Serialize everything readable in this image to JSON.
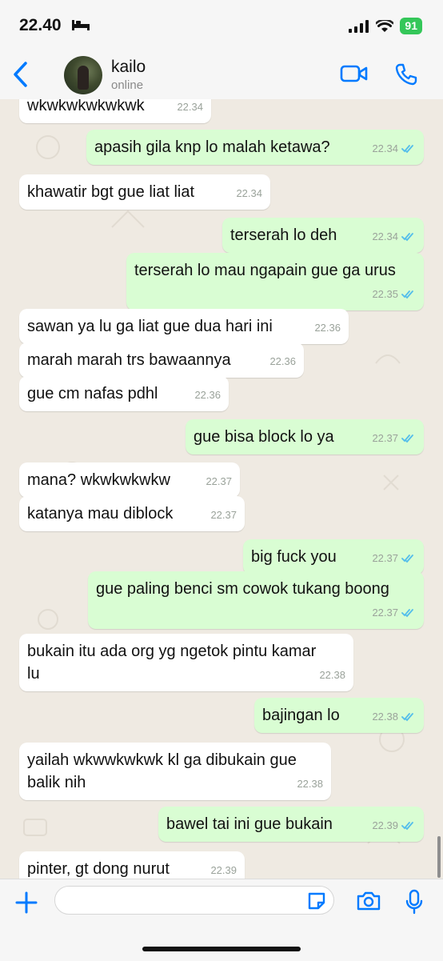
{
  "status_bar": {
    "time": "22.40",
    "battery": "91"
  },
  "header": {
    "contact_name": "kailo",
    "contact_status": "online"
  },
  "messages": [
    {
      "dir": "in",
      "text": "wkwkwkwkwkwk",
      "time": "22.34",
      "read": false
    },
    {
      "dir": "out",
      "text": "apasih gila knp lo malah ketawa?",
      "time": "22.34",
      "read": true
    },
    {
      "dir": "in",
      "text": "khawatir bgt gue liat liat",
      "time": "22.34",
      "read": false
    },
    {
      "dir": "out",
      "text": "terserah lo deh",
      "time": "22.34",
      "read": true
    },
    {
      "dir": "out",
      "text": "terserah lo mau ngapain gue ga urus",
      "time": "22.35",
      "read": true
    },
    {
      "dir": "in",
      "text": "sawan ya lu ga liat gue dua hari ini",
      "time": "22.36",
      "read": false
    },
    {
      "dir": "in",
      "text": "marah marah trs bawaannya",
      "time": "22.36",
      "read": false
    },
    {
      "dir": "in",
      "text": "gue cm nafas pdhl",
      "time": "22.36",
      "read": false
    },
    {
      "dir": "out",
      "text": "gue bisa block lo ya",
      "time": "22.37",
      "read": true
    },
    {
      "dir": "in",
      "text": "mana? wkwkwkwkw",
      "time": "22.37",
      "read": false
    },
    {
      "dir": "in",
      "text": "katanya mau diblock",
      "time": "22.37",
      "read": false
    },
    {
      "dir": "out",
      "text": "big fuck you",
      "time": "22.37",
      "read": true
    },
    {
      "dir": "out",
      "text": "gue paling benci sm cowok tukang boong",
      "time": "22.37",
      "read": true
    },
    {
      "dir": "in",
      "text": "bukain itu ada org yg ngetok pintu kamar\nlu",
      "time": "22.38",
      "read": false
    },
    {
      "dir": "out",
      "text": "bajingan lo",
      "time": "22.38",
      "read": true
    },
    {
      "dir": "in",
      "text": "yailah wkwwkwkwk kl ga dibukain gue\nbalik nih",
      "time": "22.38",
      "read": false
    },
    {
      "dir": "out",
      "text": "bawel tai ini gue bukain",
      "time": "22.39",
      "read": true
    },
    {
      "dir": "in",
      "text": "pinter, gt dong nurut",
      "time": "22.39",
      "read": false
    }
  ],
  "input": {
    "placeholder": ""
  },
  "icons": {
    "back": "chevron-left-icon",
    "video": "video-call-icon",
    "call": "phone-icon",
    "plus": "plus-icon",
    "sticker": "sticker-icon",
    "camera": "camera-icon",
    "mic": "microphone-icon"
  },
  "colors": {
    "accent": "#007aff",
    "outgoing": "#d9fdd3",
    "incoming": "#ffffff",
    "read_ticks": "#53bdeb"
  }
}
